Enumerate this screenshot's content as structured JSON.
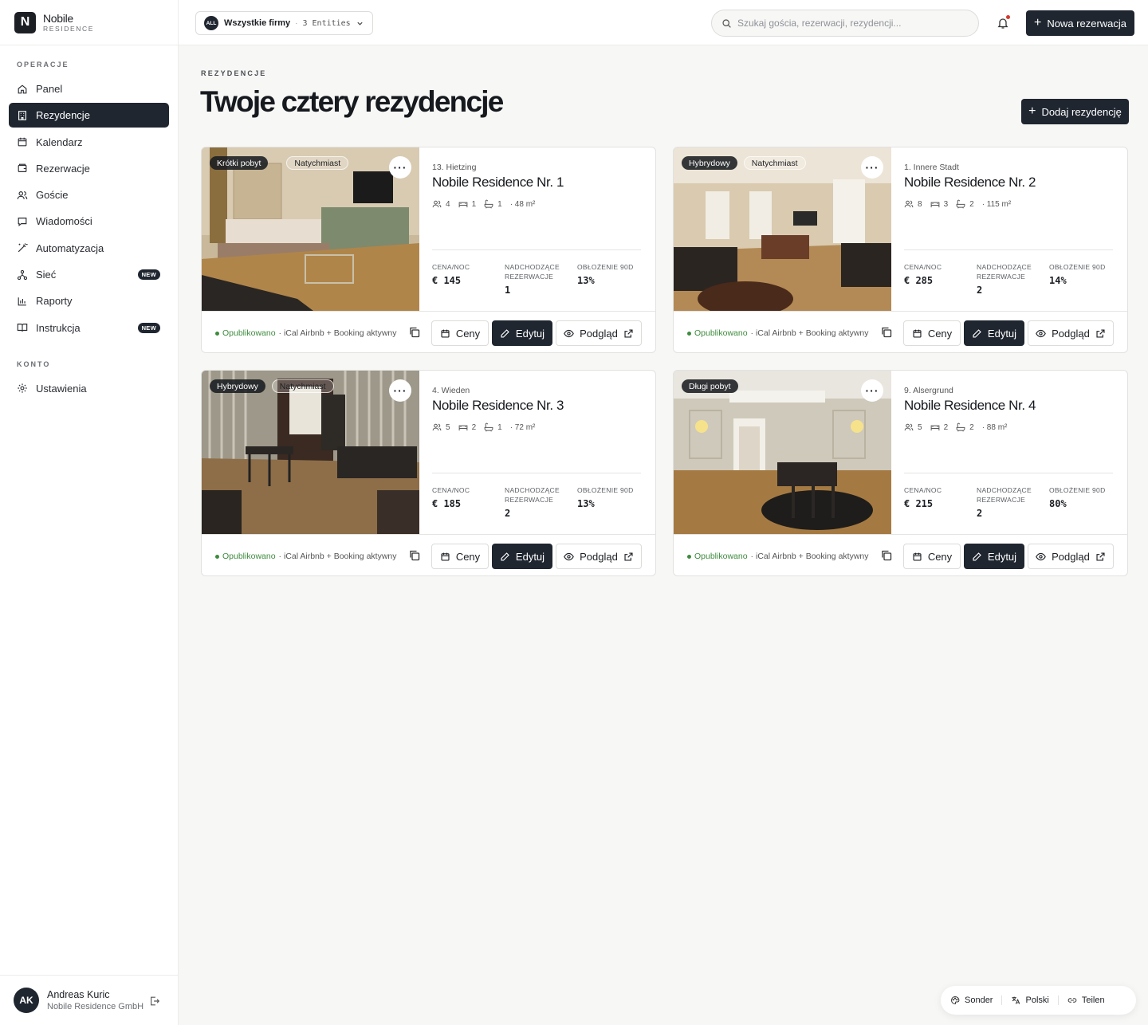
{
  "brand": {
    "mark": "N",
    "name": "Nobile",
    "sub": "RESIDENCE"
  },
  "sidebar": {
    "sections": [
      {
        "label": "OPERACJE"
      },
      {
        "label": "KONTO"
      }
    ],
    "items": [
      {
        "label": "Panel",
        "icon": "home-icon"
      },
      {
        "label": "Rezydencje",
        "icon": "building-icon",
        "active": true
      },
      {
        "label": "Kalendarz",
        "icon": "calendar-icon"
      },
      {
        "label": "Rezerwacje",
        "icon": "wallet-icon"
      },
      {
        "label": "Goście",
        "icon": "users-icon"
      },
      {
        "label": "Wiadomości",
        "icon": "message-icon"
      },
      {
        "label": "Automatyzacja",
        "icon": "wand-icon"
      },
      {
        "label": "Sieć",
        "icon": "network-icon",
        "badge": "NEW"
      },
      {
        "label": "Raporty",
        "icon": "chart-icon"
      },
      {
        "label": "Instrukcja",
        "icon": "book-icon",
        "badge": "NEW"
      },
      {
        "label": "Ustawienia",
        "icon": "gear-icon"
      }
    ],
    "user": {
      "initials": "AK",
      "name": "Andreas Kuric",
      "org": "Nobile Residence GmbH"
    }
  },
  "topbar": {
    "company": {
      "chip": "ALL",
      "name": "Wszystkie firmy",
      "separator": "·",
      "count": "3 Entities"
    },
    "search_placeholder": "Szukaj gościa, rezerwacji, rezydencji...",
    "new_reservation": "Nowa rezerwacja"
  },
  "page": {
    "eyebrow": "REZYDENCJE",
    "title": "Twoje cztery rezydencje",
    "add_button": "Dodaj rezydencję"
  },
  "labels": {
    "price": "CENA/NOC",
    "upcoming": "NADCHODZĄCE REZERWACJE",
    "occupancy": "OBŁOŻENIE 90D",
    "published": "Opublikowano",
    "sync": "· iCal Airbnb + Booking aktywny",
    "prices_btn": "Ceny",
    "edit_btn": "Edytuj",
    "preview_btn": "Podgląd"
  },
  "residences": [
    {
      "tags": [
        "Krótki pobyt",
        "Natychmiast"
      ],
      "district": "13. Hietzing",
      "name": "Nobile Residence Nr. 1",
      "guests": "4",
      "bedrooms": "1",
      "baths": "1",
      "area": "· 48 m²",
      "price": "€ 145",
      "upcoming": "1",
      "occupancy": "13%",
      "photo": "bedroom"
    },
    {
      "tags": [
        "Hybrydowy",
        "Natychmiast"
      ],
      "district": "1. Innere Stadt",
      "name": "Nobile Residence Nr. 2",
      "guests": "8",
      "bedrooms": "3",
      "baths": "2",
      "area": "· 115 m²",
      "price": "€ 285",
      "upcoming": "2",
      "occupancy": "14%",
      "photo": "living"
    },
    {
      "tags": [
        "Hybrydowy",
        "Natychmiast"
      ],
      "district": "4. Wieden",
      "name": "Nobile Residence Nr. 3",
      "guests": "5",
      "bedrooms": "2",
      "baths": "1",
      "area": "· 72 m²",
      "price": "€ 185",
      "upcoming": "2",
      "occupancy": "13%",
      "photo": "dining"
    },
    {
      "tags": [
        "Długi pobyt"
      ],
      "district": "9. Alsergrund",
      "name": "Nobile Residence Nr. 4",
      "guests": "5",
      "bedrooms": "2",
      "baths": "2",
      "area": "· 88 m²",
      "price": "€ 215",
      "upcoming": "2",
      "occupancy": "80%",
      "photo": "hall"
    }
  ],
  "floatbar": {
    "sonder": "Sonder",
    "language": "Polski",
    "share": "Teilen"
  },
  "colors": {
    "accent": "#1f2630",
    "published": "#3d8b3d",
    "notification": "#d23b2c"
  }
}
